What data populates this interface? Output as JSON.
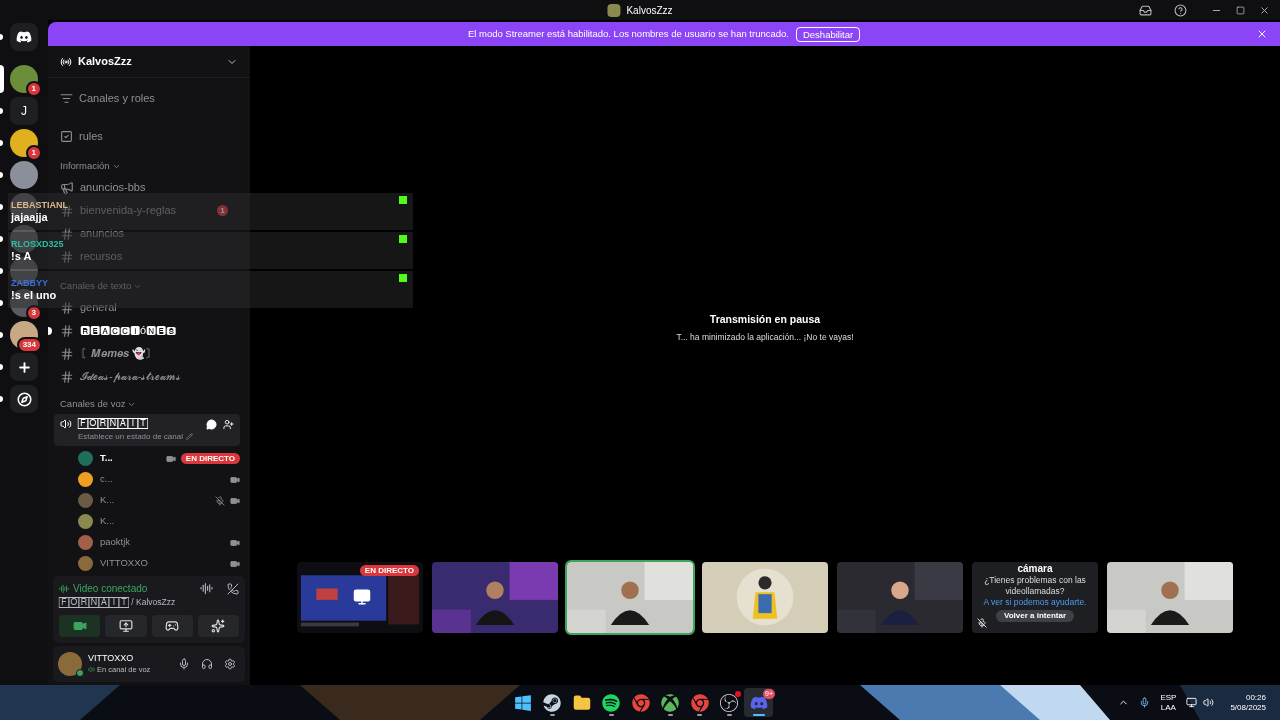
{
  "window": {
    "title": "KalvosZzz"
  },
  "banner": {
    "text": "El modo Streamer está habilitado. Los nombres de usuario se han truncado.",
    "button": "Deshabilitar"
  },
  "servers": [
    {
      "kind": "logo",
      "selected": false
    },
    {
      "kind": "avatar",
      "color": "#6b8e3a",
      "badge": "1",
      "selected": true
    },
    {
      "kind": "letter",
      "label": "J",
      "selected": false
    },
    {
      "kind": "avatar",
      "color": "#e0b020",
      "badge": "1",
      "selected": false
    },
    {
      "kind": "avatar",
      "color": "#8a8f99",
      "selected": false
    },
    {
      "kind": "avatar",
      "selected": false
    },
    {
      "kind": "avatar",
      "selected": false
    },
    {
      "kind": "avatar",
      "selected": false
    },
    {
      "kind": "avatar",
      "badge": "3",
      "selected": false
    },
    {
      "kind": "avatar",
      "color": "#c9a884",
      "badge": "334",
      "selected": false
    },
    {
      "kind": "add",
      "selected": false
    },
    {
      "kind": "discover",
      "selected": false
    }
  ],
  "server": {
    "name": "KalvosZzz"
  },
  "nav_items": [
    {
      "kind": "browse",
      "label": "Canales y roles"
    },
    {
      "kind": "rules",
      "label": "rules"
    }
  ],
  "categories": [
    {
      "name": "Información",
      "expanded": true,
      "channels": [
        {
          "kind": "announcement",
          "name": "anuncios-bbs",
          "unread": false
        },
        {
          "kind": "text",
          "name": "bienvenida-y-reglas",
          "unread": false,
          "mentions": "1"
        },
        {
          "kind": "text",
          "name": "anuncios",
          "unread": false
        },
        {
          "kind": "text",
          "name": "recursos",
          "unread": false
        }
      ]
    },
    {
      "name": "Canales de texto",
      "expanded": true,
      "channels": [
        {
          "kind": "text",
          "name": "general",
          "unread": false
        },
        {
          "kind": "text",
          "name": "🆁🅴🅰🅲🅲🅸ó🅽🅴🆂",
          "unread": true
        },
        {
          "kind": "text",
          "name": "〘𝑴𝒆𝒎𝒆𝒔 👻〙",
          "unread": false
        },
        {
          "kind": "text",
          "name": "𝓘𝓭𝓮𝓪𝓼-𝓹𝓪𝓻𝓪-𝓼𝓽𝓻𝓮𝓪𝓶𝓼",
          "unread": false
        }
      ]
    }
  ],
  "voice": {
    "category": "Canales de voz",
    "expanded": true,
    "channel": {
      "name": "🄵🄾🅁🄽🄰🄸🅃",
      "status": "Establece un estado de canal"
    },
    "members": [
      {
        "name": "T...",
        "color": "#1f6f5a",
        "video": true,
        "live": "EN DIRECTO",
        "muted": false
      },
      {
        "name": "c...",
        "color": "#f0a020",
        "video": true,
        "muted": false
      },
      {
        "name": "K...",
        "color": "#6b5a45",
        "video": true,
        "muted": true
      },
      {
        "name": "K...",
        "color": "#8a8a50",
        "video": false,
        "muted": false
      },
      {
        "name": "paoktjk",
        "color": "#a0604a",
        "video": true,
        "muted": false
      },
      {
        "name": "VITTOXXO",
        "color": "#8a6a3a",
        "video": true,
        "muted": false
      }
    ]
  },
  "connection": {
    "status": "Video conectado",
    "location": "🄵🄾🅁🄽🄰🄸🅃 / KalvosZzz",
    "buttons": [
      {
        "kind": "camera",
        "on": true
      },
      {
        "kind": "screen",
        "on": false
      },
      {
        "kind": "activity",
        "on": false
      },
      {
        "kind": "soundboard",
        "on": false
      }
    ]
  },
  "user": {
    "name": "VITTOXXO",
    "status": "En canal de voz"
  },
  "chat_overlay": [
    {
      "author": "LEBASTIANL",
      "color": "#d9b98a",
      "text": "jajaajja"
    },
    {
      "author": "RLOSXD325",
      "color": "#2bbfa0",
      "text": "!s A"
    },
    {
      "author": "ZABBYY",
      "color": "#3a6fd8",
      "text": "!s el uno"
    }
  ],
  "stage": {
    "title": "Transmisión en pausa",
    "subtitle": "T... ha minimizado la aplicación... ¡No te vayas!"
  },
  "tiles": [
    {
      "kind": "screen",
      "live": "EN DIRECTO",
      "selected": false
    },
    {
      "kind": "camera",
      "selected": false
    },
    {
      "kind": "camera",
      "selected": true
    },
    {
      "kind": "avatar",
      "selected": false
    },
    {
      "kind": "camera",
      "selected": false
    },
    {
      "kind": "error",
      "heading": "cámara",
      "text": "¿Tienes problemas con las videollamadas?",
      "link": "A ver si podemos ayudarte.",
      "button": "Volver a intentar",
      "selected": false
    },
    {
      "kind": "camera",
      "selected": false
    }
  ],
  "taskbar": {
    "apps": [
      {
        "kind": "start",
        "running": false,
        "active": false
      },
      {
        "kind": "steam",
        "running": true,
        "active": false
      },
      {
        "kind": "files",
        "running": false,
        "active": false
      },
      {
        "kind": "spotify",
        "running": true,
        "active": false
      },
      {
        "kind": "chrome",
        "running": false,
        "active": false
      },
      {
        "kind": "xbox",
        "running": true,
        "active": false
      },
      {
        "kind": "chrome",
        "running": true,
        "active": false
      },
      {
        "kind": "obs",
        "running": true,
        "active": false,
        "recording": true
      },
      {
        "kind": "discord",
        "running": true,
        "active": true,
        "badge": "9+"
      }
    ],
    "language": [
      "ESP",
      "LAA"
    ],
    "time": "00:26",
    "date": "5/08/2025"
  }
}
